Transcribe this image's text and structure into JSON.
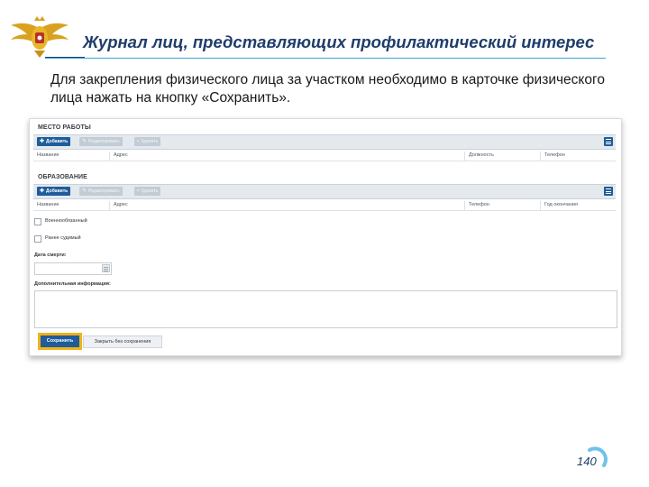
{
  "header": {
    "title": "Журнал лиц, представляющих профилактический интерес",
    "subtitle": "Для закрепления физического лица за участком необходимо в карточке физического лица нажать на кнопку «Сохранить»."
  },
  "screenshot": {
    "workplace": {
      "title": "МЕСТО РАБОТЫ",
      "add_label": "Добавить",
      "edit_label": "Редактировать",
      "delete_label": "Удалить",
      "columns": [
        "Название",
        "Адрес",
        "Должность",
        "Телефон"
      ]
    },
    "education": {
      "title": "ОБРАЗОВАНИЕ",
      "add_label": "Добавить",
      "edit_label": "Редактировать",
      "delete_label": "Удалить",
      "columns": [
        "Название",
        "Адрес",
        "Телефон",
        "Год окончания"
      ]
    },
    "military_label": "Военнообязанный",
    "military_checked": false,
    "convicted_label": "Ранее судимый",
    "convicted_checked": false,
    "death_date_label": "Дата смерти:",
    "death_date_value": "",
    "additional_info_label": "Дополнительная информация:",
    "additional_info_value": "",
    "save_label": "Сохранить",
    "close_label": "Закрыть без сохранения",
    "highlight_color": "#f2b21a"
  },
  "footer": {
    "page_number": "140"
  },
  "colors": {
    "title": "#1f3d6b",
    "rule": "#3aa3d9",
    "primary_button": "#1e5c9a"
  }
}
